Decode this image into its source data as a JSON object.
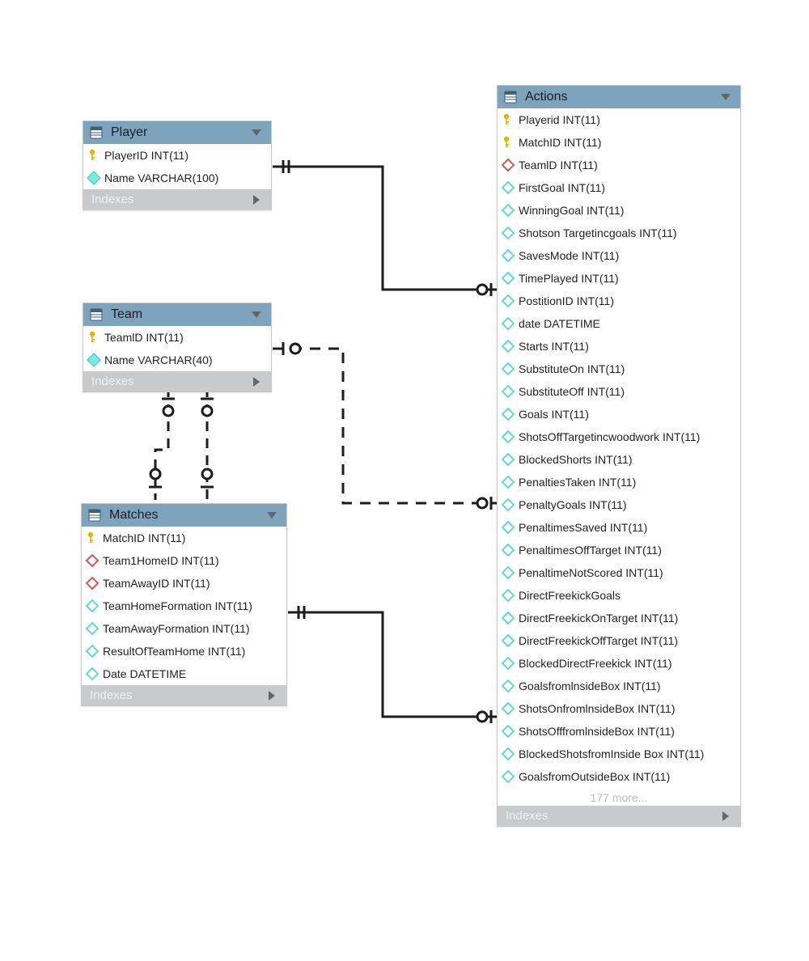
{
  "colors": {
    "header": "#7da3bd",
    "indexes_bg": "#c9cacc",
    "indexes_text": "#f0f0f0",
    "key": "#e6b400",
    "diamond_cyan_fill": "#7ef0e6",
    "diamond_red_stroke": "#d05a5a",
    "diamond_border": "#57c1be"
  },
  "tables": {
    "player": {
      "title": "Player",
      "indexes_label": "Indexes",
      "columns": [
        {
          "icon": "key",
          "label": "PlayerID INT(11)"
        },
        {
          "icon": "diamond-solid",
          "label": "Name VARCHAR(100)"
        }
      ]
    },
    "team": {
      "title": "Team",
      "indexes_label": "Indexes",
      "columns": [
        {
          "icon": "key",
          "label": "TeamlD INT(11)"
        },
        {
          "icon": "diamond-solid",
          "label": "Name VARCHAR(40)"
        }
      ]
    },
    "matches": {
      "title": "Matches",
      "indexes_label": "Indexes",
      "columns": [
        {
          "icon": "key",
          "label": "MatchID INT(11)"
        },
        {
          "icon": "diamond-red",
          "label": "Team1HomeID INT(11)"
        },
        {
          "icon": "diamond-red",
          "label": "TeamAwayID INT(11)"
        },
        {
          "icon": "diamond-open",
          "label": "TeamHomeFormation INT(11)"
        },
        {
          "icon": "diamond-open",
          "label": "TeamAwayFormation INT(11)"
        },
        {
          "icon": "diamond-open",
          "label": "ResultOfTeamHome INT(11)"
        },
        {
          "icon": "diamond-open",
          "label": "Date DATETIME"
        }
      ]
    },
    "actions": {
      "title": "Actions",
      "indexes_label": "Indexes",
      "more_label": "177 more...",
      "columns": [
        {
          "icon": "key",
          "label": "Playerid INT(11)"
        },
        {
          "icon": "key",
          "label": "MatchID INT(11)"
        },
        {
          "icon": "diamond-red",
          "label": "TeamlD INT(11)"
        },
        {
          "icon": "diamond-open",
          "label": "FirstGoal INT(11)"
        },
        {
          "icon": "diamond-open",
          "label": "WinningGoal INT(11)"
        },
        {
          "icon": "diamond-open",
          "label": "Shotson Targetincgoals INT(11)"
        },
        {
          "icon": "diamond-open",
          "label": "SavesMode INT(11)"
        },
        {
          "icon": "diamond-open",
          "label": "TimePlayed INT(11)"
        },
        {
          "icon": "diamond-open",
          "label": "PostitionID INT(11)"
        },
        {
          "icon": "diamond-open",
          "label": "date DATETIME"
        },
        {
          "icon": "diamond-open",
          "label": "Starts INT(11)"
        },
        {
          "icon": "diamond-open",
          "label": "SubstituteOn INT(11)"
        },
        {
          "icon": "diamond-open",
          "label": "SubstituteOff INT(11)"
        },
        {
          "icon": "diamond-open",
          "label": "Goals INT(11)"
        },
        {
          "icon": "diamond-open",
          "label": "ShotsOffTargetincwoodwork INT(11)"
        },
        {
          "icon": "diamond-open",
          "label": "BlockedShorts INT(11)"
        },
        {
          "icon": "diamond-open",
          "label": "PenaltiesTaken INT(11)"
        },
        {
          "icon": "diamond-open",
          "label": "PenaltyGoals INT(11)"
        },
        {
          "icon": "diamond-open",
          "label": "PenaltimesSaved INT(11)"
        },
        {
          "icon": "diamond-open",
          "label": "PenaltimesOffTarget INT(11)"
        },
        {
          "icon": "diamond-open",
          "label": "PenaltimeNotScored INT(11)"
        },
        {
          "icon": "diamond-open",
          "label": "DirectFreekickGoals"
        },
        {
          "icon": "diamond-open",
          "label": "DirectFreekickOnTarget INT(11)"
        },
        {
          "icon": "diamond-open",
          "label": "DirectFreekickOffTarget INT(11)"
        },
        {
          "icon": "diamond-open",
          "label": "BlockedDirectFreekick INT(11)"
        },
        {
          "icon": "diamond-open",
          "label": "GoalsfromlnsideBox INT(11)"
        },
        {
          "icon": "diamond-open",
          "label": "ShotsOnfromlnsideBox INT(11)"
        },
        {
          "icon": "diamond-open",
          "label": "ShotsOfffromlnsideBox INT(11)"
        },
        {
          "icon": "diamond-open",
          "label": "BlockedShotsfromInside Box INT(11)"
        },
        {
          "icon": "diamond-open",
          "label": "GoalsfromOutsideBox INT(11)"
        }
      ]
    }
  }
}
